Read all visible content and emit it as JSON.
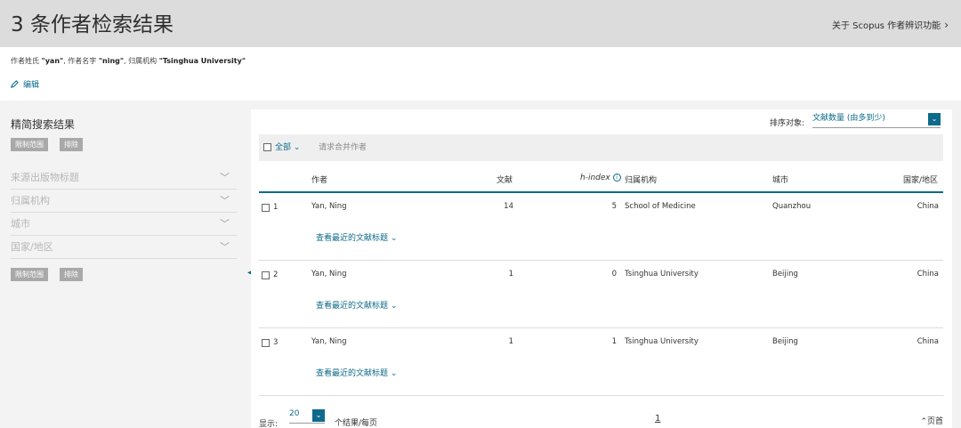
{
  "header": {
    "title": "3 条作者检索结果",
    "about_link": "关于 Scopus 作者辨识功能"
  },
  "query": {
    "prefix1": "作者姓氏 ",
    "lastname": "\"yan\"",
    "prefix2": ", 作者名字 ",
    "firstname": "\"ning\"",
    "prefix3": ", 归属机构 ",
    "affiliation": "\"Tsinghua University\"",
    "edit_label": "编辑"
  },
  "sidebar": {
    "title": "精简搜索结果",
    "limit_label": "限制范围",
    "exclude_label": "排除",
    "facets": [
      "来源出版物标题",
      "归属机构",
      "城市",
      "国家/地区"
    ]
  },
  "results": {
    "sort_label": "排序对象:",
    "sort_value": "文献数量 (由多到少)",
    "select_all": "全部",
    "merge_label": "请求合并作者",
    "columns": {
      "author": "作者",
      "documents": "文献",
      "hindex": "h-index",
      "affiliation": "归属机构",
      "city": "城市",
      "country": "国家/地区"
    },
    "rows": [
      {
        "num": "1",
        "author": "Yan, Ning",
        "documents": "14",
        "hindex": "5",
        "affiliation": "School of Medicine",
        "city": "Quanzhou",
        "country": "China",
        "recent": "查看最近的文献标题"
      },
      {
        "num": "2",
        "author": "Yan, Ning",
        "documents": "1",
        "hindex": "0",
        "affiliation": "Tsinghua University",
        "city": "Beijing",
        "country": "China",
        "recent": "查看最近的文献标题"
      },
      {
        "num": "3",
        "author": "Yan, Ning",
        "documents": "1",
        "hindex": "1",
        "affiliation": "Tsinghua University",
        "city": "Beijing",
        "country": "China",
        "recent": "查看最近的文献标题"
      }
    ]
  },
  "footer": {
    "show_label": "显示:",
    "per_page": "20",
    "per_page_label": "个结果/每页",
    "page": "1",
    "top_label": "页首"
  },
  "colors": {
    "accent": "#0c6a8a",
    "header_bg": "#dcdcdc",
    "chip": "#a9a9a9"
  }
}
